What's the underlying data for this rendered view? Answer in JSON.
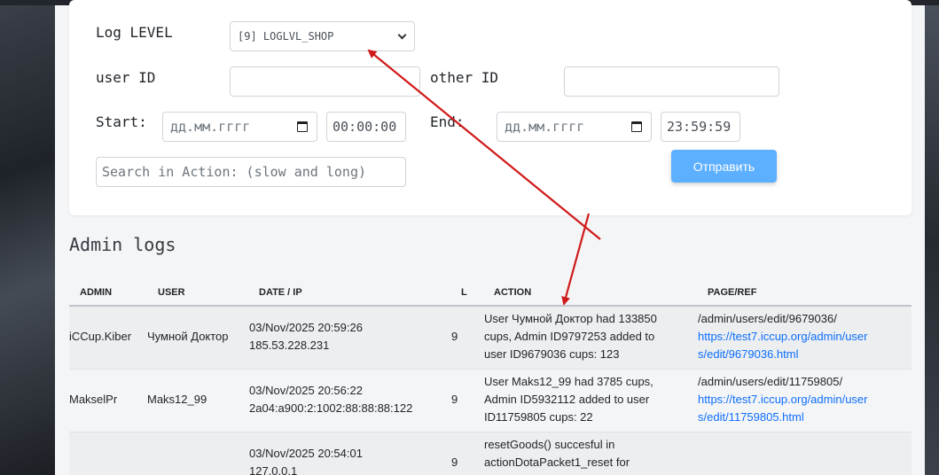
{
  "form": {
    "log_level_label": "Log LEVEL",
    "log_level_value": "[9] LOGLVL_SHOP",
    "user_id_label": "user ID",
    "other_id_label": "other ID",
    "start_label": "Start:",
    "end_label": "End:",
    "date_placeholder": "дд.мм.гггг",
    "start_time": "00:00:00",
    "end_time": "23:59:59",
    "search_placeholder": "Search in Action: (slow and long)",
    "submit_label": "Отправить"
  },
  "section_title": "Admin logs",
  "table": {
    "headers": [
      "ADMIN",
      "USER",
      "DATE / IP",
      "L",
      "ACTION",
      "PAGE/REF"
    ],
    "rows": [
      {
        "admin": "iCCup.Kiber",
        "user": "Чумной Доктор",
        "date": "03/Nov/2025 20:59:26",
        "ip": "185.53.228.231",
        "level": "9",
        "action_lines": [
          "User Чумной Доктор had 133850",
          "cups, Admin ID9797253 added to",
          "user ID9679036 cups: 123"
        ],
        "page": "/admin/users/edit/9679036/",
        "ref_lines": [
          "https://test7.iccup.org/admin/user",
          "s/edit/9679036.html"
        ]
      },
      {
        "admin": "MakselPr",
        "user": "Maks12_99",
        "date": "03/Nov/2025 20:56:22",
        "ip": "2a04:a900:2:1002:88:88:88:122",
        "level": "9",
        "action_lines": [
          "User Maks12_99 had 3785 cups,",
          "Admin ID5932112 added to user",
          "ID11759805 cups: 22"
        ],
        "page": "/admin/users/edit/11759805/",
        "ref_lines": [
          "https://test7.iccup.org/admin/user",
          "s/edit/11759805.html"
        ]
      },
      {
        "admin": "",
        "user": "",
        "date": "03/Nov/2025 20:54:01",
        "ip": "127.0.0.1",
        "level": "9",
        "action_lines": [
          "resetGoods() succesful in",
          "actionDotaPacket1_reset for"
        ],
        "page": "",
        "ref_lines": []
      }
    ]
  },
  "colors": {
    "accent_button": "#5dafff",
    "annotation_arrow": "#d01919",
    "link": "#0d6efd"
  }
}
